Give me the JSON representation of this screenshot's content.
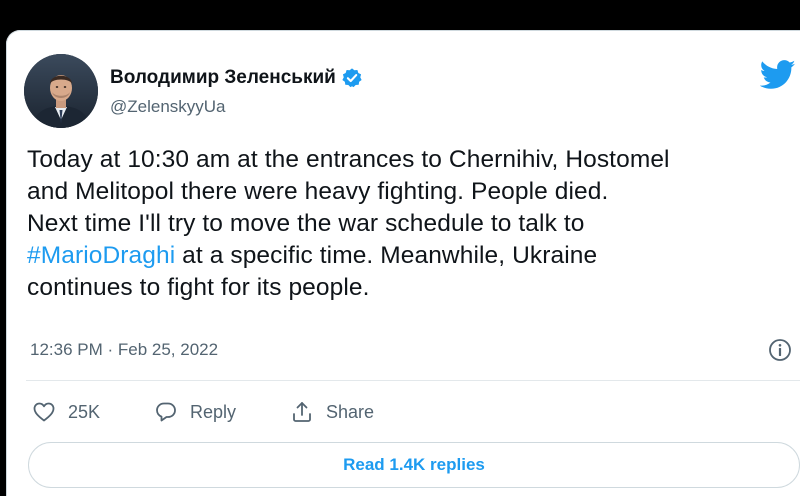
{
  "tweet": {
    "author": {
      "display_name": "Володимир Зеленський",
      "handle": "@ZelenskyyUa",
      "verified_icon": "verified-badge-icon",
      "avatar": "profile-photo"
    },
    "text_lines": [
      {
        "text": "Today at 10:30 am at the entrances to Chernihiv, Hostomel"
      },
      {
        "text": "and Melitopol there were heavy fighting. People died."
      },
      {
        "text": "Next time I'll try to move the war schedule to talk to"
      },
      {
        "hashtag": "#MarioDraghi",
        "text": " at a specific time. Meanwhile, Ukraine"
      },
      {
        "text": "continues to fight for its people."
      }
    ],
    "timestamp": "12:36 PM · Feb 25, 2022",
    "actions": {
      "like": {
        "icon": "heart-icon",
        "count": "25K"
      },
      "reply": {
        "icon": "reply-bubble-icon",
        "label": "Reply"
      },
      "share": {
        "icon": "share-icon",
        "label": "Share"
      }
    },
    "replies_button_label": "Read 1.4K replies",
    "brand_icon": "twitter-bird-icon",
    "info_icon": "info-icon"
  },
  "colors": {
    "accent": "#1d9bf0",
    "text_primary": "#0f1419",
    "text_secondary": "#536471",
    "border": "#cfd9de"
  }
}
